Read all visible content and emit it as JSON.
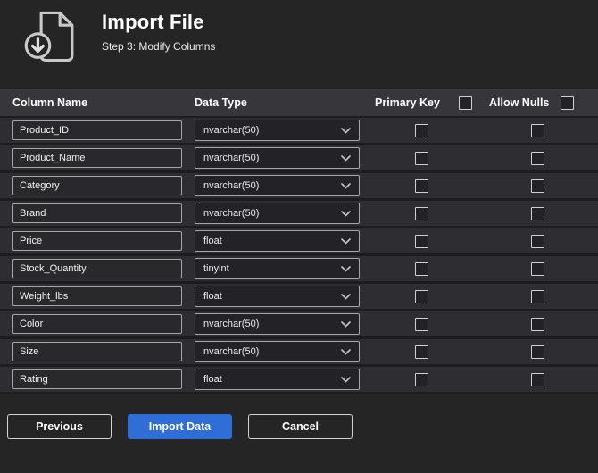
{
  "header": {
    "title": "Import File",
    "subtitle": "Step 3: Modify Columns"
  },
  "table": {
    "headers": {
      "column_name": "Column Name",
      "data_type": "Data Type",
      "primary_key": "Primary Key",
      "allow_nulls": "Allow Nulls"
    },
    "header_checkboxes": {
      "primary_key_checked": false,
      "allow_nulls_checked": false
    },
    "rows": [
      {
        "name": "Product_ID",
        "type": "nvarchar(50)",
        "primary_key": false,
        "allow_nulls": false
      },
      {
        "name": "Product_Name",
        "type": "nvarchar(50)",
        "primary_key": false,
        "allow_nulls": false
      },
      {
        "name": "Category",
        "type": "nvarchar(50)",
        "primary_key": false,
        "allow_nulls": false
      },
      {
        "name": "Brand",
        "type": "nvarchar(50)",
        "primary_key": false,
        "allow_nulls": false
      },
      {
        "name": "Price",
        "type": "float",
        "primary_key": false,
        "allow_nulls": false
      },
      {
        "name": "Stock_Quantity",
        "type": "tinyint",
        "primary_key": false,
        "allow_nulls": false
      },
      {
        "name": "Weight_lbs",
        "type": "float",
        "primary_key": false,
        "allow_nulls": false
      },
      {
        "name": "Color",
        "type": "nvarchar(50)",
        "primary_key": false,
        "allow_nulls": false
      },
      {
        "name": "Size",
        "type": "nvarchar(50)",
        "primary_key": false,
        "allow_nulls": false
      },
      {
        "name": "Rating",
        "type": "float",
        "primary_key": false,
        "allow_nulls": false
      }
    ]
  },
  "footer": {
    "previous_label": "Previous",
    "import_label": "Import Data",
    "cancel_label": "Cancel"
  },
  "colors": {
    "accent_blue": "#2f6ed6",
    "background": "#252526",
    "row_background": "#2e2e32",
    "header_row_background": "#37373b"
  }
}
